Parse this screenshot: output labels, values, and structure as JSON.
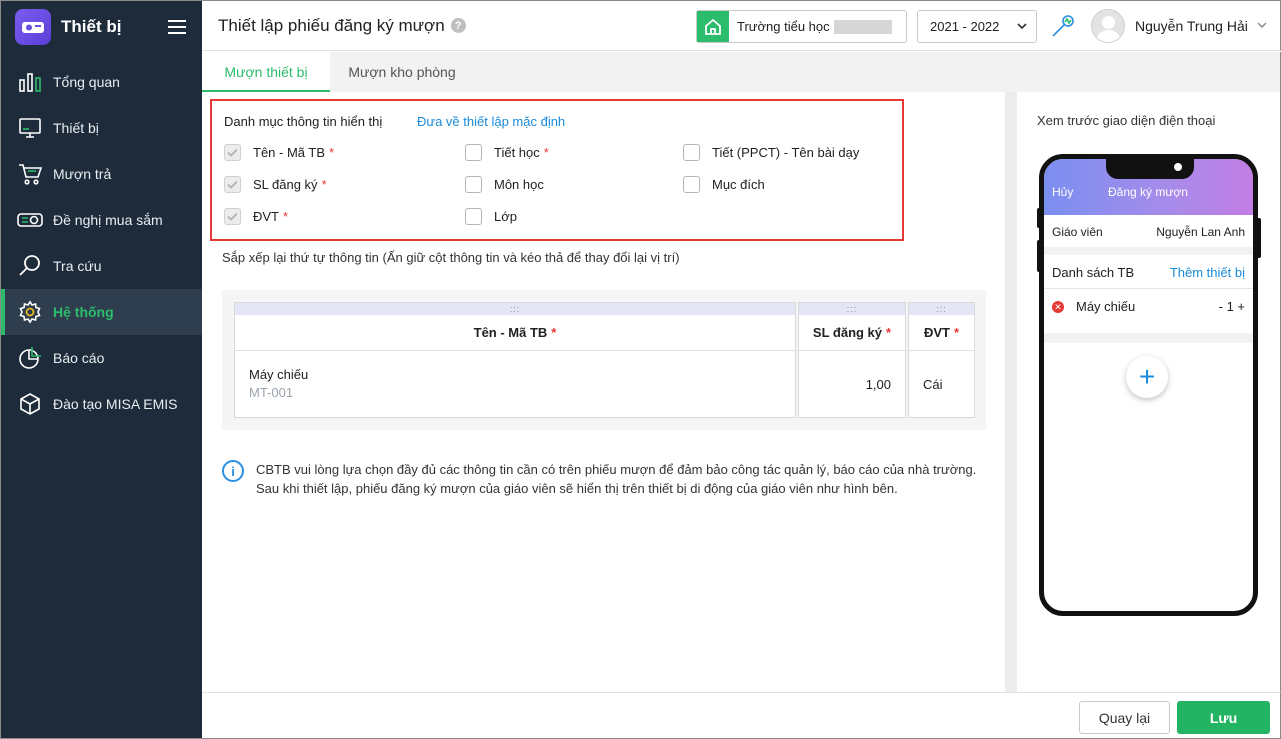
{
  "app": {
    "title": "Thiết bị"
  },
  "sidebar": {
    "items": [
      {
        "label": "Tổng quan",
        "icon": "chart-bars-icon"
      },
      {
        "label": "Thiết bị",
        "icon": "monitor-icon"
      },
      {
        "label": "Mượn trả",
        "icon": "cart-icon"
      },
      {
        "label": "Đề nghị mua sắm",
        "icon": "projector-icon"
      },
      {
        "label": "Tra cứu",
        "icon": "search-icon"
      },
      {
        "label": "Hệ thống",
        "icon": "gear-icon",
        "active": true
      },
      {
        "label": "Báo cáo",
        "icon": "pie-chart-icon"
      },
      {
        "label": "Đào tạo MISA EMIS",
        "icon": "box-icon"
      }
    ]
  },
  "header": {
    "page_title": "Thiết lập phiếu đăng ký mượn",
    "help": "?",
    "school": "Trường tiểu học",
    "year": "2021 - 2022",
    "user_name": "Nguyễn Trung Hải"
  },
  "tabs": [
    {
      "label": "Mượn thiết bị",
      "active": true
    },
    {
      "label": "Mượn kho phòng",
      "active": false
    }
  ],
  "settings": {
    "heading": "Danh mục thông tin hiển thị",
    "reset_link": "Đưa về thiết lập mặc định",
    "required_mark": "*",
    "options": {
      "ten_ma_tb": {
        "label": "Tên - Mã TB",
        "checked": true,
        "required": true
      },
      "sl_dang_ky": {
        "label": "SL đăng ký",
        "checked": true,
        "required": true
      },
      "dvt": {
        "label": "ĐVT",
        "checked": true,
        "required": true
      },
      "tiet_hoc": {
        "label": "Tiết học",
        "checked": false,
        "required": true
      },
      "mon_hoc": {
        "label": "Môn học",
        "checked": false,
        "required": false
      },
      "lop": {
        "label": "Lớp",
        "checked": false,
        "required": false
      },
      "tiet_ppct": {
        "label": "Tiết (PPCT) - Tên bài dạy",
        "checked": false,
        "required": false
      },
      "muc_dich": {
        "label": "Mục đích",
        "checked": false,
        "required": false
      }
    },
    "reorder_note": "Sắp xếp lại thứ tự thông tin (Ấn giữ cột thông tin và kéo thả để thay đổi lại vị trí)"
  },
  "table": {
    "grip": ":::",
    "columns": [
      "Tên - Mã TB",
      "SL đăng ký",
      "ĐVT"
    ],
    "row": {
      "name": "Máy chiếu",
      "code": "MT-001",
      "qty": "1,00",
      "unit": "Cái"
    }
  },
  "info_note": "CBTB vui lòng lựa chọn đầy đủ các thông tin cần có trên phiếu mượn để đảm bảo công tác quản lý, báo cáo của nhà trường. Sau khi thiết lập, phiếu đăng ký mượn của giáo viên sẽ hiển thị trên thiết bị di động của giáo viên như hình bên.",
  "preview": {
    "title": "Xem trước giao diện điện thoại",
    "phone": {
      "cancel": "Hủy",
      "header_title": "Đăng ký mượn",
      "teacher_label": "Giáo viên",
      "teacher_name": "Nguyễn Lan Anh",
      "list_label": "Danh sách TB",
      "add_link": "Thêm thiết bị",
      "item_name": "Máy chiếu",
      "item_qty": "- 1 +",
      "fab": "+"
    }
  },
  "footer": {
    "back": "Quay lại",
    "save": "Lưu"
  },
  "colors": {
    "accent": "#2bbd6b",
    "sidebar_bg": "#1e2b3a",
    "link": "#1a8bd9",
    "required": "#e53935",
    "highlight_border": "#e53935"
  }
}
